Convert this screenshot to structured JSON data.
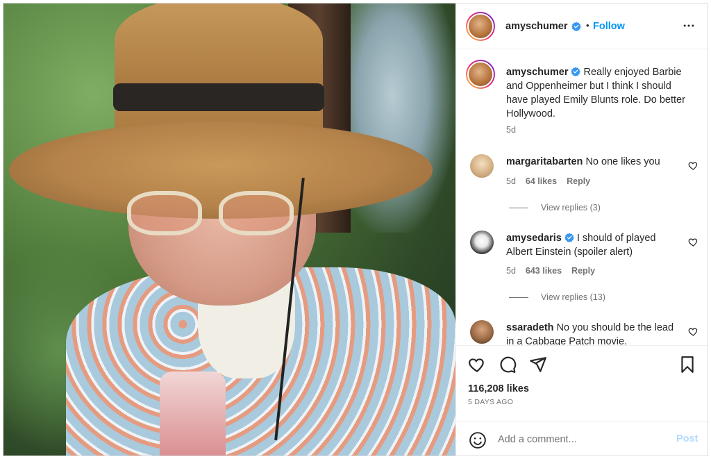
{
  "post": {
    "author": "amyschumer",
    "follow_label": "Follow",
    "dot": "•",
    "caption_text": "Really enjoyed Barbie and Oppenheimer but I think I should have played Emily Blunts role. Do better Hollywood.",
    "caption_age": "5d"
  },
  "comments": [
    {
      "username": "margaritabarten",
      "text": "No one likes you",
      "age": "5d",
      "likes": "64 likes",
      "reply": "Reply",
      "view_replies": "View replies (3)",
      "verified": false
    },
    {
      "username": "amysedaris",
      "text": "I should of played Albert Einstein (spoiler alert)",
      "age": "5d",
      "likes": "643 likes",
      "reply": "Reply",
      "view_replies": "View replies (13)",
      "verified": true
    },
    {
      "username": "ssaradeth",
      "text": "No you should be the lead in a Cabbage Patch movie.",
      "verified": false
    }
  ],
  "stats": {
    "likes": "116,208 likes",
    "posted": "5 DAYS AGO"
  },
  "composer": {
    "placeholder": "Add a comment...",
    "post_label": "Post"
  },
  "colors": {
    "link": "#0095f6",
    "muted": "#737373",
    "verified": "#3897f0",
    "post_disabled": "#b3dbff"
  },
  "icons": [
    "verified-badge-icon",
    "more-options-icon",
    "heart-icon",
    "comment-icon",
    "share-icon",
    "bookmark-icon",
    "emoji-icon"
  ]
}
